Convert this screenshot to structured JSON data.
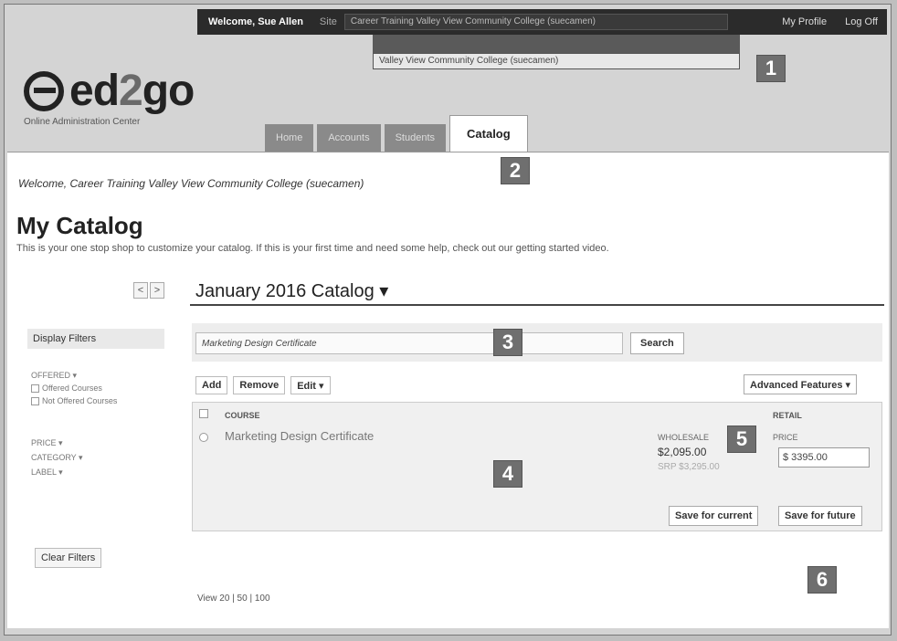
{
  "topbar": {
    "welcome": "Welcome, Sue Allen",
    "site_label": "Site",
    "site_value": "Career Training Valley View Community College (suecamen)",
    "my_profile": "My Profile",
    "log_off": "Log Off"
  },
  "dropdown": {
    "option": "Valley View Community College (suecamen)"
  },
  "logo": {
    "brand_ed": "ed",
    "brand_2": "2",
    "brand_go": "go",
    "subtitle": "Online Administration Center"
  },
  "tabs": [
    {
      "label": "Home"
    },
    {
      "label": "Accounts"
    },
    {
      "label": "Students"
    },
    {
      "label": "Catalog"
    }
  ],
  "page": {
    "welcome": "Welcome, Career Training Valley View Community College (suecamen)",
    "title": "My Catalog",
    "intro": "This is your one stop shop to customize your catalog. If this is your first time and need some help, check out our getting started video."
  },
  "catalog": {
    "prev": "<",
    "next": ">",
    "title": "January 2016 Catalog ▾"
  },
  "filters": {
    "header": "Display Filters",
    "offered_label": "OFFERED ▾",
    "offered_courses": "Offered Courses",
    "not_offered_courses": "Not Offered Courses",
    "price": "PRICE ▾",
    "category": "CATEGORY ▾",
    "label": "LABEL ▾",
    "clear": "Clear Filters"
  },
  "search": {
    "value": "Marketing Design Certificate",
    "button": "Search"
  },
  "actions": {
    "add": "Add",
    "remove": "Remove",
    "edit": "Edit ▾",
    "advanced": "Advanced Features ▾"
  },
  "table": {
    "col_course": "COURSE",
    "col_retail": "RETAIL",
    "rows": [
      {
        "course": "Marketing Design Certificate",
        "wholesale_label": "WHOLESALE",
        "wholesale_price": "$2,095.00",
        "srp": "SRP $3,295.00",
        "price_label": "PRICE",
        "currency": "$",
        "retail_price": "3395.00"
      }
    ],
    "save_current": "Save for current",
    "save_future": "Save for future"
  },
  "pager": {
    "text": "View 20 | 50 | 100"
  },
  "badges": [
    "1",
    "2",
    "3",
    "4",
    "5",
    "6"
  ]
}
